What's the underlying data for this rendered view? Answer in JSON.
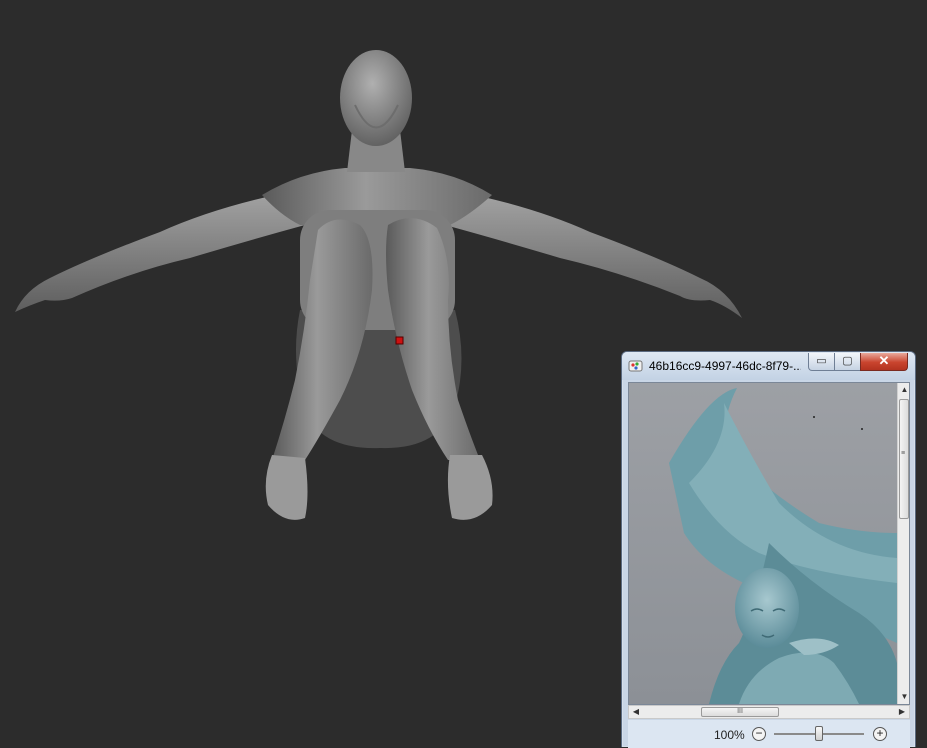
{
  "viewer": {
    "title": "46b16cc9-4997-46dc-8f79-...",
    "min_glyph": "▭",
    "max_glyph": "▢",
    "close_glyph": "✕",
    "zoom_label": "100%",
    "zoom_out_glyph": "−",
    "zoom_in_glyph": "+",
    "scroll_up_glyph": "▲",
    "scroll_down_glyph": "▼",
    "scroll_left_glyph": "◀",
    "scroll_right_glyph": "▶",
    "grip_glyph": "III"
  },
  "colors": {
    "background": "#2c2c2c",
    "model_gray": "#8c8c8c",
    "statue_teal": "#7fa9b3",
    "marker_red": "#cc1111"
  }
}
